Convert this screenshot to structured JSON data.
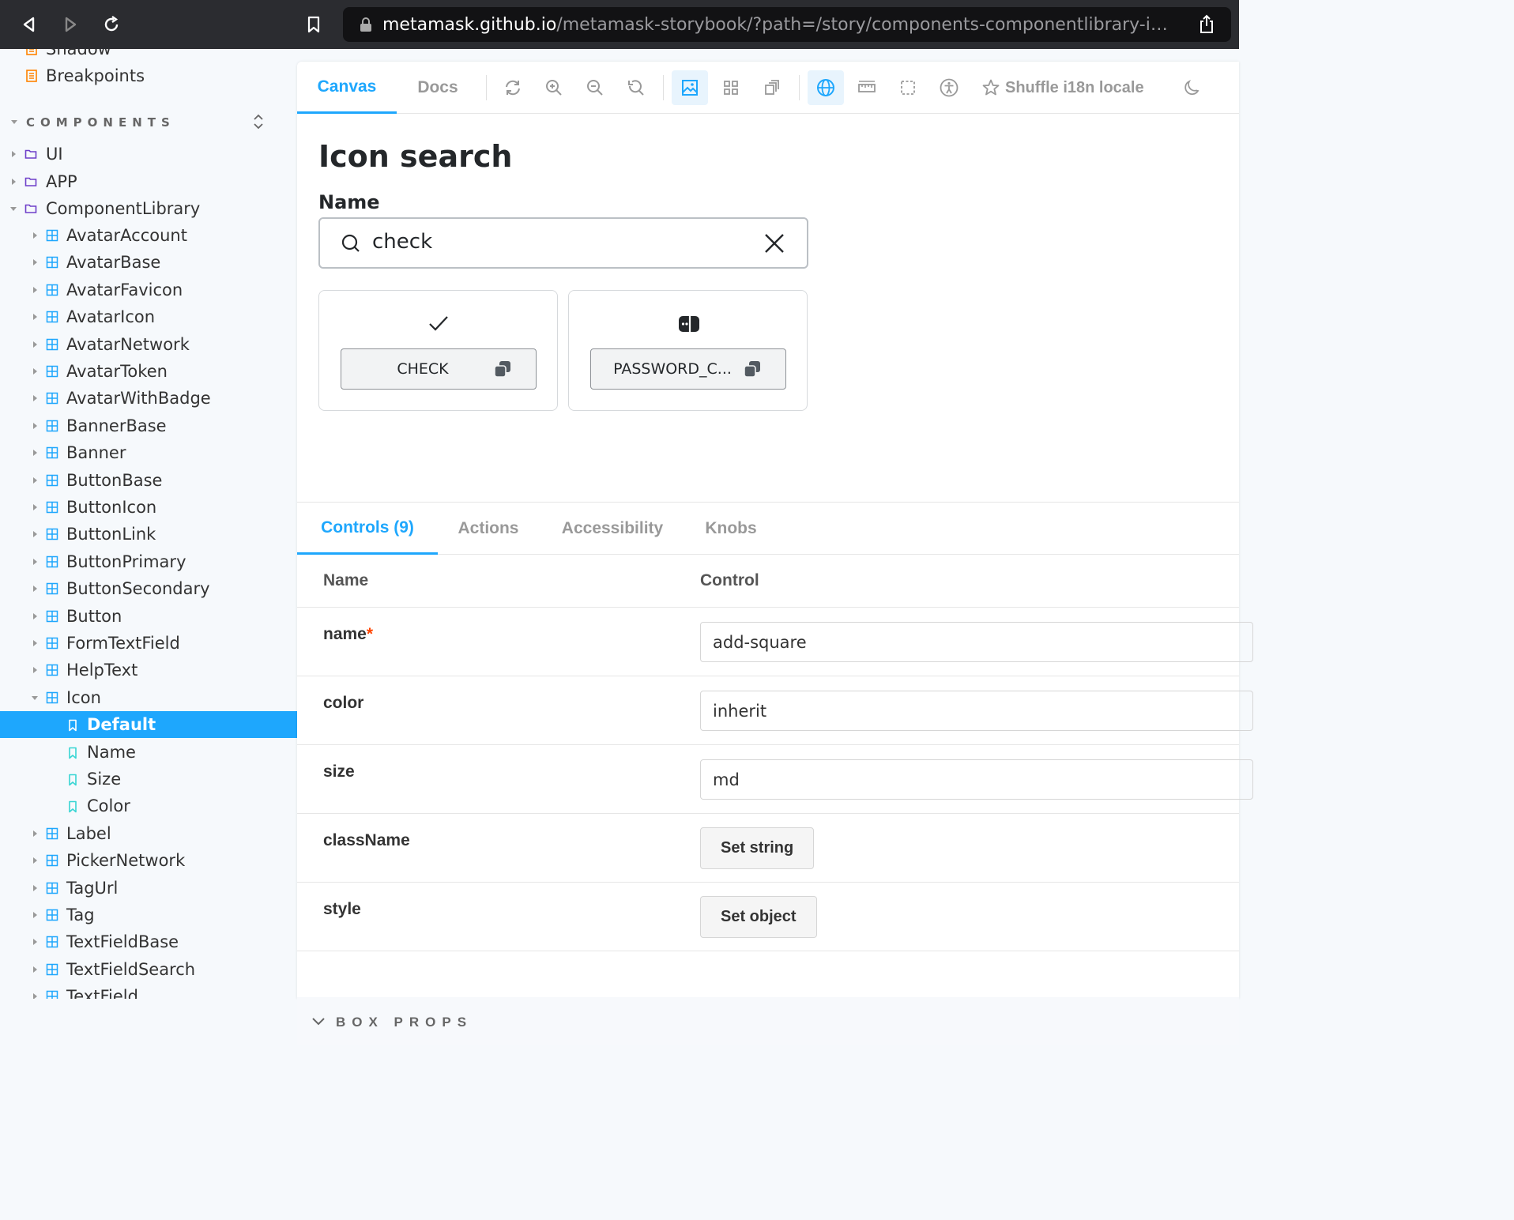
{
  "browser": {
    "url_host": "metamask.github.io",
    "url_path": "/metamask-storybook/?path=/story/components-componentlibrary-ico..."
  },
  "sidebar": {
    "top_items": [
      {
        "label": "Shadow"
      },
      {
        "label": "Breakpoints"
      }
    ],
    "section_title": "COMPONENTS",
    "folders": [
      {
        "label": "UI"
      },
      {
        "label": "APP"
      },
      {
        "label": "ComponentLibrary"
      }
    ],
    "components": [
      {
        "label": "AvatarAccount"
      },
      {
        "label": "AvatarBase"
      },
      {
        "label": "AvatarFavicon"
      },
      {
        "label": "AvatarIcon"
      },
      {
        "label": "AvatarNetwork"
      },
      {
        "label": "AvatarToken"
      },
      {
        "label": "AvatarWithBadge"
      },
      {
        "label": "BannerBase"
      },
      {
        "label": "Banner"
      },
      {
        "label": "ButtonBase"
      },
      {
        "label": "ButtonIcon"
      },
      {
        "label": "ButtonLink"
      },
      {
        "label": "ButtonPrimary"
      },
      {
        "label": "ButtonSecondary"
      },
      {
        "label": "Button"
      },
      {
        "label": "FormTextField"
      },
      {
        "label": "HelpText"
      },
      {
        "label": "Icon"
      }
    ],
    "stories": [
      {
        "label": "Default"
      },
      {
        "label": "Name"
      },
      {
        "label": "Size"
      },
      {
        "label": "Color"
      }
    ],
    "components_after": [
      {
        "label": "Label"
      },
      {
        "label": "PickerNetwork"
      },
      {
        "label": "TagUrl"
      },
      {
        "label": "Tag"
      },
      {
        "label": "TextFieldBase"
      },
      {
        "label": "TextFieldSearch"
      },
      {
        "label": "TextField"
      }
    ]
  },
  "toolbar": {
    "tabs": [
      {
        "label": "Canvas"
      },
      {
        "label": "Docs"
      }
    ],
    "shuffle_label": "Shuffle i18n locale"
  },
  "story": {
    "title": "Icon search",
    "name_label": "Name",
    "search_value": "check",
    "results": [
      {
        "label": "CHECK",
        "icon": "check-icon"
      },
      {
        "label": "PASSWORD_C...",
        "icon": "password-check-icon"
      }
    ]
  },
  "addons": {
    "tabs": [
      {
        "label": "Controls (9)"
      },
      {
        "label": "Actions"
      },
      {
        "label": "Accessibility"
      },
      {
        "label": "Knobs"
      }
    ],
    "headers": {
      "name": "Name",
      "control": "Control"
    },
    "rows": [
      {
        "name": "name",
        "value": "add-square"
      },
      {
        "name": "color",
        "value": "inherit"
      },
      {
        "name": "size",
        "value": "md"
      },
      {
        "name": "className",
        "button": "Set string"
      },
      {
        "name": "style",
        "button": "Set object"
      }
    ],
    "required_mark": "*",
    "box_props_label": "BOX PROPS"
  },
  "colors": {
    "accent": "#1ea7fd",
    "folder": "#6e3fc9",
    "component": "#1ea7fd",
    "story": "#37d5d3",
    "doc": "#ff8300"
  }
}
